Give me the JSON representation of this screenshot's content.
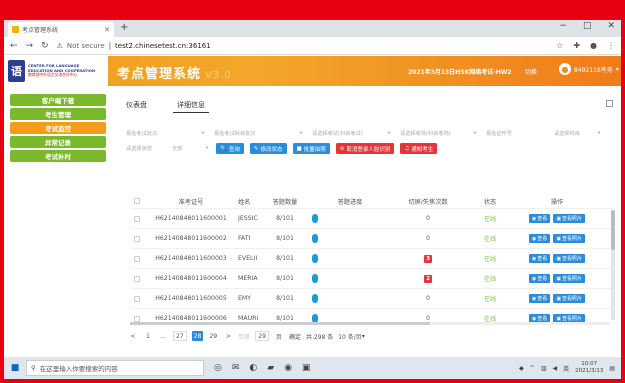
{
  "browser": {
    "tab_title": "考点管理系统",
    "new_tab": "+",
    "url_security": "Not secure",
    "url": "test2.chinesetest.cn:36161"
  },
  "header": {
    "logo_text_1": "CENTER FOR LANGUAGE",
    "logo_text_2": "EDUCATION AND COOPERATION",
    "logo_text_cn": "教育部中外语言交流合作中心",
    "system_title": "考点管理系统",
    "version": "V3.0",
    "exam_info": "2021年3月13日HSK网络考试-HW2",
    "switch_label": "切换",
    "user_name": "8492118考务"
  },
  "sidebar": {
    "items": [
      {
        "label": "客户端下载",
        "color": "green"
      },
      {
        "label": "考生管理",
        "color": "green"
      },
      {
        "label": "考试监控",
        "color": "orange"
      },
      {
        "label": "异常记录",
        "color": "green"
      },
      {
        "label": "考试补时",
        "color": "green"
      }
    ]
  },
  "subtabs": [
    "仪表盘",
    "详细信息"
  ],
  "filters": {
    "row1": [
      {
        "placeholder": "报名考试批次"
      },
      {
        "placeholder": "报名考试科目批次"
      },
      {
        "placeholder": "请选择考试(科目考试)"
      },
      {
        "placeholder": "请选择考场(科目考场)"
      },
      {
        "placeholder": "报名证件号"
      },
      {
        "placeholder": "请选择科目"
      }
    ],
    "row2": [
      {
        "placeholder": "请选择状态"
      },
      {
        "placeholder": "全部"
      }
    ],
    "buttons": [
      {
        "label": "查询",
        "color": "blue",
        "icon": "search-icon"
      },
      {
        "label": "修改状态",
        "color": "blue",
        "icon": "edit-icon"
      },
      {
        "label": "批量拍照",
        "color": "blue",
        "icon": "camera-icon"
      },
      {
        "label": "取消登录人脸识别",
        "color": "red",
        "icon": "cancel-icon"
      },
      {
        "label": "通知考生",
        "color": "red",
        "icon": "bell-icon"
      }
    ]
  },
  "table": {
    "headers": [
      "准考证号",
      "姓名",
      "答题数量",
      "答题进度",
      "切屏/失焦次数",
      "状态",
      "操作"
    ],
    "rows": [
      {
        "no": "H62140848011600001",
        "name": "JESSIC",
        "q": "8/101",
        "switch": "0",
        "switch_alert": false,
        "state": "在线"
      },
      {
        "no": "H62140848011600002",
        "name": "FATI",
        "q": "8/101",
        "switch": "0",
        "switch_alert": false,
        "state": "在线"
      },
      {
        "no": "H62140848011600003",
        "name": "EVELII",
        "q": "8/101",
        "switch": "3",
        "switch_alert": true,
        "state": "在线"
      },
      {
        "no": "H62140848011600004",
        "name": "MERIA",
        "q": "8/101",
        "switch": "2",
        "switch_alert": true,
        "state": "在线"
      },
      {
        "no": "H62140848011600005",
        "name": "EMY",
        "q": "8/101",
        "switch": "0",
        "switch_alert": false,
        "state": "在线"
      },
      {
        "no": "H62140848011600006",
        "name": "MAURI",
        "q": "8/101",
        "switch": "0",
        "switch_alert": false,
        "state": "在线"
      }
    ],
    "op_view": "查看",
    "op_photo": "查看照片"
  },
  "pager": {
    "prev": "<",
    "first": "1",
    "ellipsis1": "...",
    "p27": "27",
    "current": "28",
    "p29": "29",
    "next": ">",
    "goto_label": "到第",
    "goto_value": "29",
    "page_unit": "页",
    "confirm": "确定",
    "total": "共 298 条",
    "page_size": "10 条/页"
  },
  "taskbar": {
    "search_placeholder": "在这里输入你要搜索的内容",
    "ime": "英",
    "time": "10:07",
    "date": "2021/3/13"
  }
}
